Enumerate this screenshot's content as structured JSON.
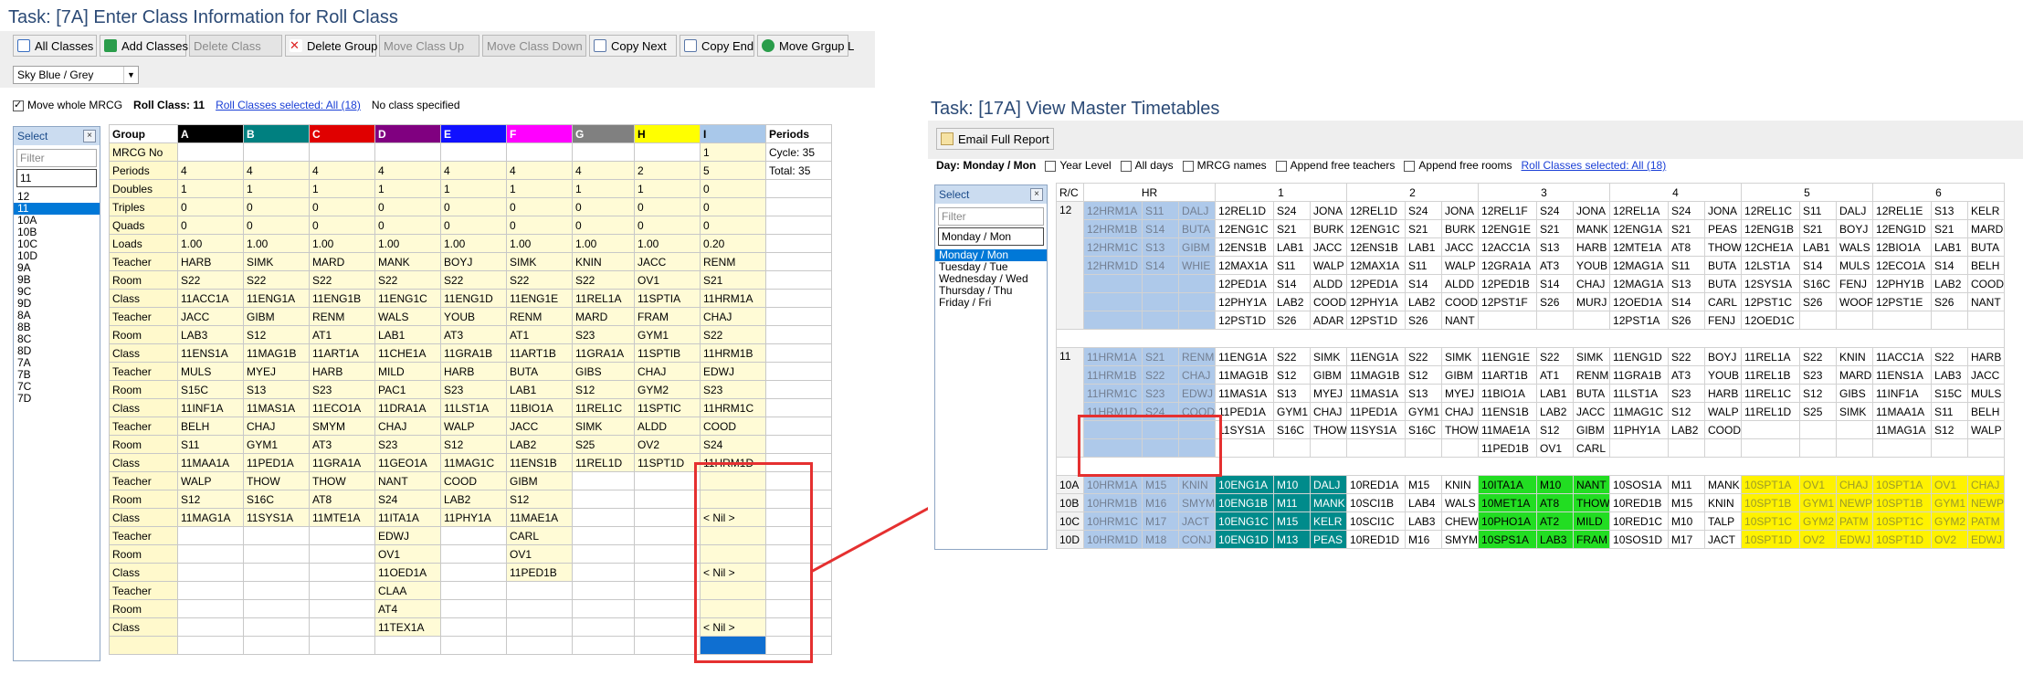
{
  "left": {
    "title": "Task: [7A] Enter Class Information for Roll Class",
    "toolbar": [
      {
        "label": "All Classes",
        "icon": "grid-icon",
        "enabled": true
      },
      {
        "label": "Add Classes",
        "icon": "add-icon",
        "enabled": true
      },
      {
        "label": "Delete Class",
        "icon": "",
        "enabled": false
      },
      {
        "label": "Delete Group",
        "icon": "close-icon",
        "enabled": true
      },
      {
        "label": "Move Class Up",
        "icon": "",
        "enabled": false
      },
      {
        "label": "Move Class Down",
        "icon": "",
        "enabled": false
      },
      {
        "label": "Copy Next",
        "icon": "copy-icon",
        "enabled": true
      },
      {
        "label": "Copy End",
        "icon": "copy-icon",
        "enabled": true
      },
      {
        "label": "Move Grgup L",
        "icon": "move-icon",
        "enabled": true
      }
    ],
    "scheme": "Sky Blue / Grey",
    "move_whole": "Move whole MRCG",
    "roll_class_label": "Roll Class: 11",
    "roll_classes_link": "Roll Classes selected: All (18)",
    "no_class": "No class specified",
    "select": {
      "title": "Select",
      "filter": "Filter",
      "value": "11",
      "items": [
        "12",
        "11",
        "10A",
        "10B",
        "10C",
        "10D",
        "9A",
        "9B",
        "9C",
        "9D",
        "8A",
        "8B",
        "8C",
        "8D",
        "7A",
        "7B",
        "7C",
        "7D"
      ],
      "selected": "11"
    },
    "grid": {
      "group_header": "Group",
      "columns": [
        {
          "name": "A",
          "color": "#000000",
          "text": "#ffffff"
        },
        {
          "name": "B",
          "color": "#008080",
          "text": "#ffffff"
        },
        {
          "name": "C",
          "color": "#e00000",
          "text": "#ffffff"
        },
        {
          "name": "D",
          "color": "#800080",
          "text": "#ffffff"
        },
        {
          "name": "E",
          "color": "#1010ff",
          "text": "#ffffff"
        },
        {
          "name": "F",
          "color": "#ff00ff",
          "text": "#ffffff"
        },
        {
          "name": "G",
          "color": "#808080",
          "text": "#ffffff"
        },
        {
          "name": "H",
          "color": "#ffff00",
          "text": "#000000"
        },
        {
          "name": "I",
          "color": "#a9c8ea",
          "text": "#000000"
        }
      ],
      "periods_header": "Periods",
      "rows": [
        {
          "label": "MRCG No",
          "cells": [
            "",
            "",
            "",
            "",
            "",
            "",
            "",
            "",
            "1"
          ]
        },
        {
          "label": "Periods",
          "cells": [
            "4",
            "4",
            "4",
            "4",
            "4",
            "4",
            "4",
            "2",
            "5"
          ]
        },
        {
          "label": "Doubles",
          "cells": [
            "1",
            "1",
            "1",
            "1",
            "1",
            "1",
            "1",
            "1",
            "0"
          ]
        },
        {
          "label": "Triples",
          "cells": [
            "0",
            "0",
            "0",
            "0",
            "0",
            "0",
            "0",
            "0",
            "0"
          ]
        },
        {
          "label": "Quads",
          "cells": [
            "0",
            "0",
            "0",
            "0",
            "0",
            "0",
            "0",
            "0",
            "0"
          ]
        },
        {
          "label": "Loads",
          "cells": [
            "1.00",
            "1.00",
            "1.00",
            "1.00",
            "1.00",
            "1.00",
            "1.00",
            "1.00",
            "0.20"
          ]
        },
        {
          "label": "Teacher",
          "cells": [
            "HARB",
            "SIMK",
            "MARD",
            "MANK",
            "BOYJ",
            "SIMK",
            "KNIN",
            "JACC",
            "RENM"
          ]
        },
        {
          "label": "Room",
          "cells": [
            "S22",
            "S22",
            "S22",
            "S22",
            "S22",
            "S22",
            "S22",
            "OV1",
            "S21"
          ]
        },
        {
          "label": "Class",
          "cells": [
            "11ACC1A",
            "11ENG1A",
            "11ENG1B",
            "11ENG1C",
            "11ENG1D",
            "11ENG1E",
            "11REL1A",
            "11SPTIA",
            "11HRM1A"
          ]
        },
        {
          "label": "Teacher",
          "cells": [
            "JACC",
            "GIBM",
            "RENM",
            "WALS",
            "YOUB",
            "RENM",
            "MARD",
            "FRAM",
            "CHAJ"
          ]
        },
        {
          "label": "Room",
          "cells": [
            "LAB3",
            "S12",
            "AT1",
            "LAB1",
            "AT3",
            "AT1",
            "S23",
            "GYM1",
            "S22"
          ]
        },
        {
          "label": "Class",
          "cells": [
            "11ENS1A",
            "11MAG1B",
            "11ART1A",
            "11CHE1A",
            "11GRA1B",
            "11ART1B",
            "11GRA1A",
            "11SPTIB",
            "11HRM1B"
          ]
        },
        {
          "label": "Teacher",
          "cells": [
            "MULS",
            "MYEJ",
            "HARB",
            "MILD",
            "HARB",
            "BUTA",
            "GIBS",
            "CHAJ",
            "EDWJ"
          ]
        },
        {
          "label": "Room",
          "cells": [
            "S15C",
            "S13",
            "S23",
            "PAC1",
            "S23",
            "LAB1",
            "S12",
            "GYM2",
            "S23"
          ]
        },
        {
          "label": "Class",
          "cells": [
            "11INF1A",
            "11MAS1A",
            "11ECO1A",
            "11DRA1A",
            "11LST1A",
            "11BIO1A",
            "11REL1C",
            "11SPTIC",
            "11HRM1C"
          ]
        },
        {
          "label": "Teacher",
          "cells": [
            "BELH",
            "CHAJ",
            "SMYM",
            "CHAJ",
            "WALP",
            "JACC",
            "SIMK",
            "ALDD",
            "COOD"
          ]
        },
        {
          "label": "Room",
          "cells": [
            "S11",
            "GYM1",
            "AT3",
            "S23",
            "S12",
            "LAB2",
            "S25",
            "OV2",
            "S24"
          ]
        },
        {
          "label": "Class",
          "cells": [
            "11MAA1A",
            "11PED1A",
            "11GRA1A",
            "11GEO1A",
            "11MAG1C",
            "11ENS1B",
            "11REL1D",
            "11SPT1D",
            "11HRM1D"
          ]
        },
        {
          "label": "Teacher",
          "cells": [
            "WALP",
            "THOW",
            "THOW",
            "NANT",
            "COOD",
            "GIBM",
            "",
            "",
            ""
          ]
        },
        {
          "label": "Room",
          "cells": [
            "S12",
            "S16C",
            "AT8",
            "S24",
            "LAB2",
            "S12",
            "",
            "",
            ""
          ]
        },
        {
          "label": "Class",
          "cells": [
            "11MAG1A",
            "11SYS1A",
            "11MTE1A",
            "11ITA1A",
            "11PHY1A",
            "11MAE1A",
            "",
            "",
            "< Nil >"
          ]
        },
        {
          "label": "Teacher",
          "cells": [
            "",
            "",
            "",
            "EDWJ",
            "",
            "CARL",
            "",
            "",
            ""
          ]
        },
        {
          "label": "Room",
          "cells": [
            "",
            "",
            "",
            "OV1",
            "",
            "OV1",
            "",
            "",
            ""
          ]
        },
        {
          "label": "Class",
          "cells": [
            "",
            "",
            "",
            "11OED1A",
            "",
            "11PED1B",
            "",
            "",
            "< Nil >"
          ]
        },
        {
          "label": "Teacher",
          "cells": [
            "",
            "",
            "",
            "CLAA",
            "",
            "",
            "",
            "",
            ""
          ]
        },
        {
          "label": "Room",
          "cells": [
            "",
            "",
            "",
            "AT4",
            "",
            "",
            "",
            "",
            ""
          ]
        },
        {
          "label": "Class",
          "cells": [
            "",
            "",
            "",
            "11TEX1A",
            "",
            "",
            "",
            "",
            "< Nil >"
          ]
        },
        {
          "label": "",
          "cells": [
            "",
            "",
            "",
            "",
            "",
            "",
            "",
            "",
            ""
          ]
        }
      ],
      "cycle": "Cycle: 35",
      "total": "Total: 35"
    }
  },
  "right": {
    "title": "Task: [17A] View Master Timetables",
    "email_button": "Email Full Report",
    "day_label": "Day: Monday / Mon",
    "options": [
      "Year Level",
      "All days",
      "MRCG names",
      "Append free teachers",
      "Append free rooms"
    ],
    "roll_classes_link": "Roll Classes selected: All (18)",
    "select": {
      "title": "Select",
      "filter": "Filter",
      "value": "Monday / Mon",
      "items": [
        "Monday / Mon",
        "Tuesday / Tue",
        "Wednesday / Wed",
        "Thursday / Thu",
        "Friday / Fri"
      ],
      "selected": "Monday / Mon"
    },
    "timetable": {
      "rc_header": "R/C",
      "period_headers": [
        "HR",
        "1",
        "2",
        "3",
        "4",
        "5",
        "6"
      ],
      "groups": [
        {
          "rc": "12",
          "rows": [
            [
              "12HRM1A",
              "S11",
              "DALJ",
              "12REL1D",
              "S24",
              "JONA",
              "12REL1D",
              "S24",
              "JONA",
              "12REL1F",
              "S24",
              "JONA",
              "12REL1A",
              "S24",
              "JONA",
              "12REL1C",
              "S11",
              "DALJ",
              "12REL1E",
              "S13",
              "KELR"
            ],
            [
              "12HRM1B",
              "S14",
              "BUTA",
              "12ENG1C",
              "S21",
              "BURK",
              "12ENG1C",
              "S21",
              "BURK",
              "12ENG1E",
              "S21",
              "MANK",
              "12ENG1A",
              "S21",
              "PEAS",
              "12ENG1B",
              "S21",
              "BOYJ",
              "12ENG1D",
              "S21",
              "MARD"
            ],
            [
              "12HRM1C",
              "S13",
              "GIBM",
              "12ENS1B",
              "LAB1",
              "JACC",
              "12ENS1B",
              "LAB1",
              "JACC",
              "12ACC1A",
              "S13",
              "HARB",
              "12MTE1A",
              "AT8",
              "THOW",
              "12CHE1A",
              "LAB1",
              "WALS",
              "12BIO1A",
              "LAB1",
              "BUTA"
            ],
            [
              "12HRM1D",
              "S14",
              "WHIE",
              "12MAX1A",
              "S11",
              "WALP",
              "12MAX1A",
              "S11",
              "WALP",
              "12GRA1A",
              "AT3",
              "YOUB",
              "12MAG1A",
              "S11",
              "BUTA",
              "12LST1A",
              "S14",
              "MULS",
              "12ECO1A",
              "S14",
              "BELH"
            ],
            [
              "",
              "",
              "",
              "12PED1A",
              "S14",
              "ALDD",
              "12PED1A",
              "S14",
              "ALDD",
              "12PED1B",
              "S14",
              "CHAJ",
              "12MAG1A",
              "S13",
              "BUTA",
              "12SYS1A",
              "S16C",
              "FENJ",
              "12PHY1B",
              "LAB2",
              "COOD"
            ],
            [
              "",
              "",
              "",
              "12PHY1A",
              "LAB2",
              "COOD",
              "12PHY1A",
              "LAB2",
              "COOD",
              "12PST1F",
              "S26",
              "MURJ",
              "12OED1A",
              "S14",
              "CARL",
              "12PST1C",
              "S26",
              "WOOP",
              "12PST1E",
              "S26",
              "NANT"
            ],
            [
              "",
              "",
              "",
              "12PST1D",
              "S26",
              "ADAR",
              "12PST1D",
              "S26",
              "NANT",
              "",
              "",
              "",
              "12PST1A",
              "S26",
              "FENJ",
              "12OED1C",
              "",
              "",
              "",
              "",
              ""
            ]
          ]
        },
        {
          "rc": "11",
          "rows": [
            [
              "11HRM1A",
              "S21",
              "RENM",
              "11ENG1A",
              "S22",
              "SIMK",
              "11ENG1A",
              "S22",
              "SIMK",
              "11ENG1E",
              "S22",
              "SIMK",
              "11ENG1D",
              "S22",
              "BOYJ",
              "11REL1A",
              "S22",
              "KNIN",
              "11ACC1A",
              "S22",
              "HARB"
            ],
            [
              "11HRM1B",
              "S22",
              "CHAJ",
              "11MAG1B",
              "S12",
              "GIBM",
              "11MAG1B",
              "S12",
              "GIBM",
              "11ART1B",
              "AT1",
              "RENM",
              "11GRA1B",
              "AT3",
              "YOUB",
              "11REL1B",
              "S23",
              "MARD",
              "11ENS1A",
              "LAB3",
              "JACC"
            ],
            [
              "11HRM1C",
              "S23",
              "EDWJ",
              "11MAS1A",
              "S13",
              "MYEJ",
              "11MAS1A",
              "S13",
              "MYEJ",
              "11BIO1A",
              "LAB1",
              "BUTA",
              "11LST1A",
              "S23",
              "HARB",
              "11REL1C",
              "S12",
              "GIBS",
              "11INF1A",
              "S15C",
              "MULS"
            ],
            [
              "11HRM1D",
              "S24",
              "COOD",
              "11PED1A",
              "GYM1",
              "CHAJ",
              "11PED1A",
              "GYM1",
              "CHAJ",
              "11ENS1B",
              "LAB2",
              "JACC",
              "11MAG1C",
              "S12",
              "WALP",
              "11REL1D",
              "S25",
              "SIMK",
              "11MAA1A",
              "S11",
              "BELH"
            ],
            [
              "",
              "",
              "",
              "11SYS1A",
              "S16C",
              "THOW",
              "11SYS1A",
              "S16C",
              "THOW",
              "11MAE1A",
              "S12",
              "GIBM",
              "11PHY1A",
              "LAB2",
              "COOD",
              "",
              "",
              "",
              "11MAG1A",
              "S12",
              "WALP"
            ],
            [
              "",
              "",
              "",
              "",
              "",
              "",
              "",
              "",
              "",
              "11PED1B",
              "OV1",
              "CARL",
              "",
              "",
              "",
              "",
              "",
              "",
              "",
              "",
              ""
            ]
          ]
        },
        {
          "rc": "10A",
          "rows": [
            [
              "10HRM1A",
              "M15",
              "KNIN",
              "10ENG1A",
              "M10",
              "DALJ",
              "10RED1A",
              "M15",
              "KNIN",
              "10ITA1A",
              "M10",
              "NANT",
              "10SOS1A",
              "M11",
              "MANK",
              "10SPT1A",
              "OV1",
              "CHAJ",
              "10SPT1A",
              "OV1",
              "CHAJ"
            ]
          ]
        },
        {
          "rc": "10B",
          "rows": [
            [
              "10HRM1B",
              "M16",
              "SMYM",
              "10ENG1B",
              "M11",
              "MANK",
              "10SCI1B",
              "LAB4",
              "WALS",
              "10MET1A",
              "AT8",
              "THOW",
              "10RED1B",
              "M15",
              "KNIN",
              "10SPT1B",
              "GYM1",
              "NEWP",
              "10SPT1B",
              "GYM1",
              "NEWP"
            ]
          ]
        },
        {
          "rc": "10C",
          "rows": [
            [
              "10HRM1C",
              "M17",
              "JACT",
              "10ENG1C",
              "M15",
              "KELR",
              "10SCI1C",
              "LAB3",
              "CHEW",
              "10PHO1A",
              "AT2",
              "MILD",
              "10RED1C",
              "M10",
              "TALP",
              "10SPT1C",
              "GYM2",
              "PATM",
              "10SPT1C",
              "GYM2",
              "PATM"
            ]
          ]
        },
        {
          "rc": "10D",
          "rows": [
            [
              "10HRM1D",
              "M18",
              "CONJ",
              "10ENG1D",
              "M13",
              "PEAS",
              "10RED1D",
              "M16",
              "SMYM",
              "10SPS1A",
              "LAB3",
              "FRAM",
              "10SOS1D",
              "M17",
              "JACT",
              "10SPT1D",
              "OV2",
              "EDWJ",
              "10SPT1D",
              "OV2",
              "EDWJ"
            ]
          ]
        }
      ]
    }
  }
}
